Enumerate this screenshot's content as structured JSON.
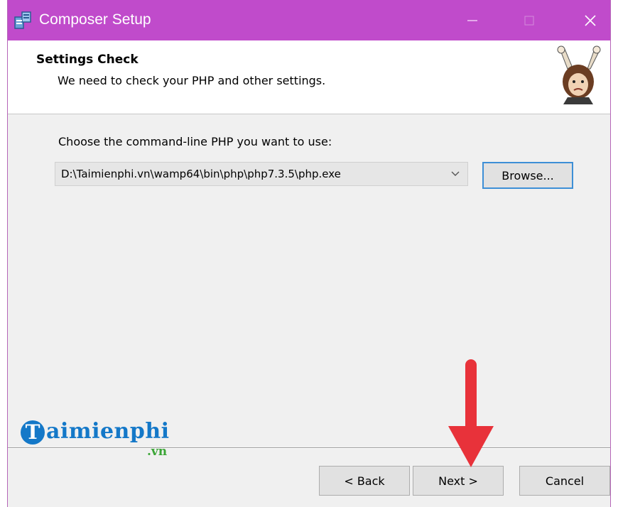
{
  "window": {
    "title": "Composer Setup"
  },
  "header": {
    "heading": "Settings Check",
    "subheading": "We need to check your PHP and other settings."
  },
  "main": {
    "prompt": "Choose the command-line PHP you want to use:",
    "php_path": "D:\\Taimienphi.vn\\wamp64\\bin\\php\\php7.3.5\\php.exe",
    "browse_label": "Browse..."
  },
  "footer": {
    "back_label": "< Back",
    "next_label": "Next >",
    "cancel_label": "Cancel"
  },
  "watermark": {
    "brand_mark": "T",
    "brand": "aimienphi",
    "tld": ".vn"
  },
  "colors": {
    "titlebar": "#c04bcb",
    "annotation_arrow": "#e8323a",
    "brand_blue": "#1478c8",
    "brand_green": "#3aa535"
  },
  "icons": {
    "app": "installer-icon",
    "minimize": "minimize-icon",
    "maximize": "maximize-icon",
    "close": "close-icon",
    "dropdown": "chevron-down-icon",
    "mascot": "composer-mascot-icon",
    "annotation": "arrow-down-icon"
  }
}
